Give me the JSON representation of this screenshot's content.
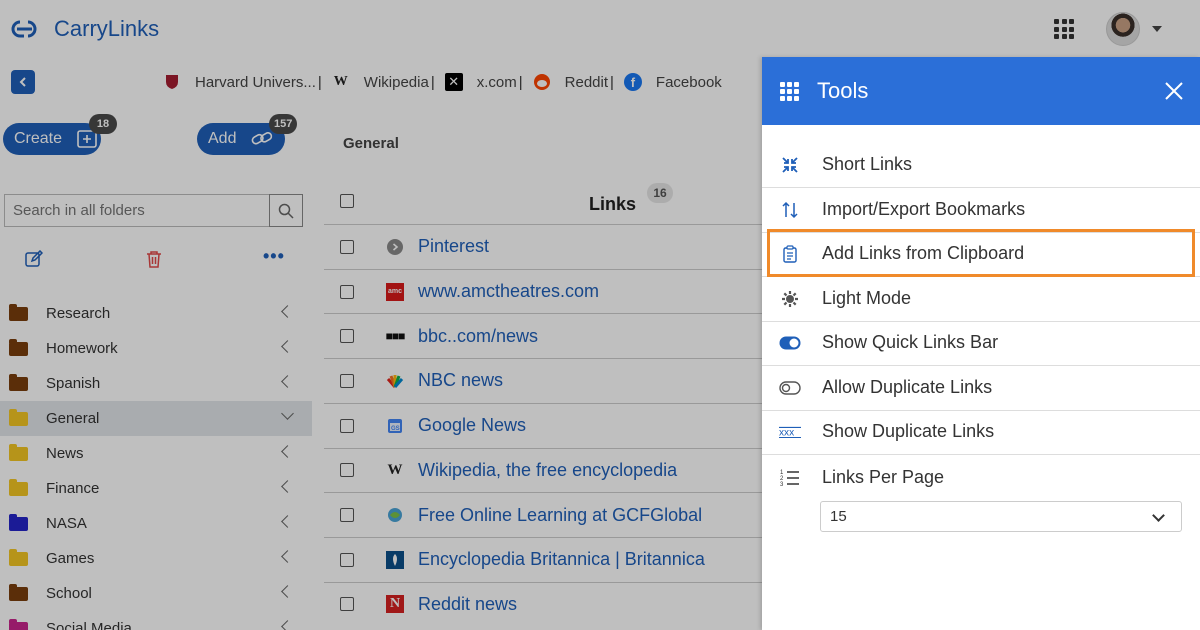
{
  "header": {
    "brand": "CarryLinks"
  },
  "bookmarks_bar": {
    "items": [
      {
        "label": "Harvard Univers...",
        "icon": "harvard-shield-icon"
      },
      {
        "label": "Wikipedia",
        "icon": "wikipedia-w-icon"
      },
      {
        "label": "x.com",
        "icon": "x-logo-icon"
      },
      {
        "label": "Reddit",
        "icon": "reddit-icon"
      },
      {
        "label": "Facebook",
        "icon": "facebook-icon"
      }
    ],
    "separator": "|"
  },
  "sidebar": {
    "create_label": "Create",
    "create_badge": "18",
    "add_label": "Add",
    "add_badge": "157",
    "search_placeholder": "Search in all folders",
    "folders": [
      {
        "name": "Research",
        "color": "#7a3e0c"
      },
      {
        "name": "Homework",
        "color": "#7a3e0c"
      },
      {
        "name": "Spanish",
        "color": "#7a3e0c"
      },
      {
        "name": "General",
        "color": "#f3c623",
        "selected": true
      },
      {
        "name": "News",
        "color": "#f3c623"
      },
      {
        "name": "Finance",
        "color": "#f3c623"
      },
      {
        "name": "NASA",
        "color": "#2424c8"
      },
      {
        "name": "Games",
        "color": "#f3c623"
      },
      {
        "name": "School",
        "color": "#7a3e0c"
      },
      {
        "name": "Social Media",
        "color": "#c8248c"
      }
    ]
  },
  "main": {
    "breadcrumb": "General",
    "links_header": "Links",
    "links_count": "16",
    "links": [
      {
        "title": "Pinterest",
        "favicon": "pinterest-icon"
      },
      {
        "title": "www.amctheatres.com",
        "favicon": "amc-icon"
      },
      {
        "title": "bbc..com/news",
        "favicon": "bbc-icon"
      },
      {
        "title": "NBC news",
        "favicon": "nbc-peacock-icon"
      },
      {
        "title": "Google News",
        "favicon": "google-news-icon"
      },
      {
        "title": "Wikipedia, the free encyclopedia",
        "favicon": "wikipedia-w-icon"
      },
      {
        "title": "Free Online Learning at GCFGlobal",
        "favicon": "gcfglobal-icon"
      },
      {
        "title": "Encyclopedia Britannica | Britannica",
        "favicon": "britannica-icon"
      },
      {
        "title": "Reddit news",
        "favicon": "n-logo-icon"
      }
    ]
  },
  "tools": {
    "title": "Tools",
    "items": [
      {
        "label": "Short Links",
        "icon": "compress-arrows-icon"
      },
      {
        "label": "Import/Export Bookmarks",
        "icon": "up-down-arrows-icon"
      },
      {
        "label": "Add Links from Clipboard",
        "icon": "clipboard-icon",
        "highlighted": true
      },
      {
        "label": "Light Mode",
        "icon": "gear-sun-icon"
      },
      {
        "label": "Show Quick Links Bar",
        "icon": "toggle-on-icon"
      },
      {
        "label": "Allow Duplicate Links",
        "icon": "toggle-off-icon"
      },
      {
        "label": "Show Duplicate Links",
        "icon": "strikethrough-xxx-icon"
      },
      {
        "label": "Links Per Page",
        "icon": "numbered-list-icon"
      }
    ],
    "links_per_page": "15"
  },
  "colors": {
    "accent": "#1f5fb8",
    "tools_header": "#2b6fd8",
    "highlight": "#f08a2a"
  }
}
